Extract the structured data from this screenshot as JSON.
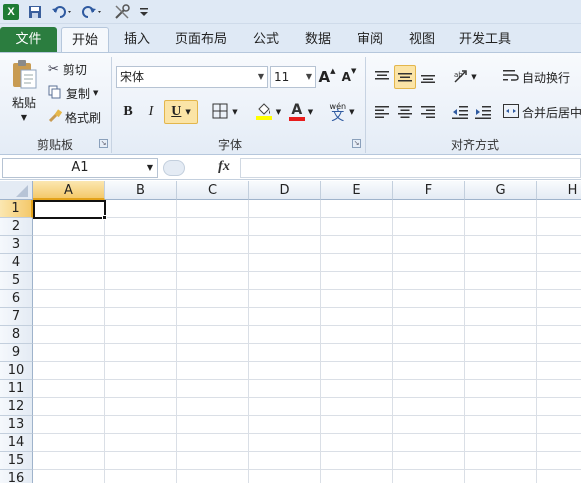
{
  "quick_access": {
    "app_icon_letter": "X",
    "save_icon": "save-icon",
    "undo_icon": "undo-icon",
    "redo_icon": "redo-icon",
    "customize_icon": "tools-icon"
  },
  "tabs": {
    "file": "文件",
    "items": [
      "开始",
      "插入",
      "页面布局",
      "公式",
      "数据",
      "审阅",
      "视图",
      "开发工具"
    ],
    "active": "开始"
  },
  "ribbon": {
    "clipboard": {
      "paste_label": "粘贴",
      "cut_label": "剪切",
      "copy_label": "复制",
      "format_painter_label": "格式刷",
      "group_label": "剪贴板"
    },
    "font": {
      "font_name": "宋体",
      "font_size": "11",
      "bold": "B",
      "italic": "I",
      "underline": "U",
      "font_color_letter": "A",
      "wen_top": "wén",
      "wen_char": "文",
      "group_label": "字体",
      "grow_label": "A",
      "shrink_label": "A"
    },
    "alignment": {
      "wrap_text_label": "自动换行",
      "merge_center_label": "合并后居中",
      "group_label": "对齐方式"
    }
  },
  "formula_bar": {
    "name_box": "A1",
    "fx_label": "fx",
    "formula_value": ""
  },
  "grid": {
    "columns": [
      "A",
      "B",
      "C",
      "D",
      "E",
      "F",
      "G",
      "H"
    ],
    "rows": [
      "1",
      "2",
      "3",
      "4",
      "5",
      "6",
      "7",
      "8",
      "9",
      "10",
      "11",
      "12",
      "13",
      "14",
      "15",
      "16"
    ],
    "selected_cell": "A1"
  },
  "colors": {
    "file_tab": "#2b7d3f",
    "selection_header": "#f4c96b",
    "ribbon_bg": "#e4ecf6"
  }
}
